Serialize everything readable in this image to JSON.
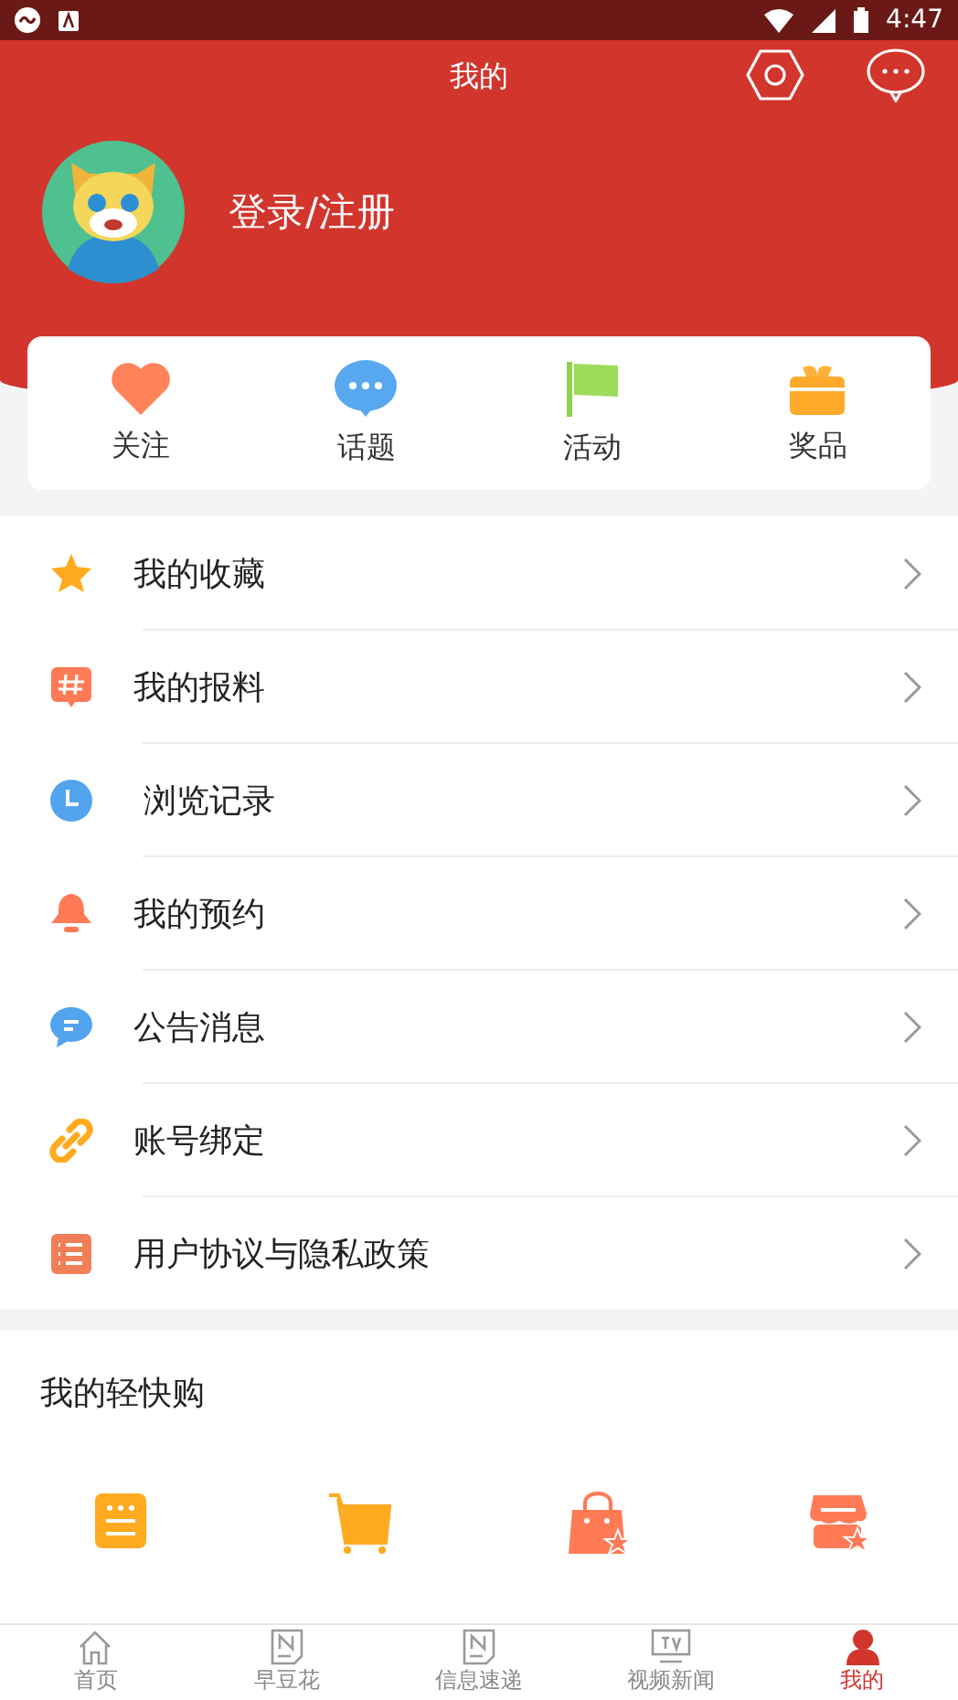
{
  "status_bar": {
    "time": "4:47"
  },
  "header": {
    "title": "我的",
    "login": "登录/注册"
  },
  "quick_actions": [
    {
      "label": "关注"
    },
    {
      "label": "话题"
    },
    {
      "label": "活动"
    },
    {
      "label": "奖品"
    }
  ],
  "menu": [
    {
      "label": "我的收藏"
    },
    {
      "label": "我的报料"
    },
    {
      "label": " 浏览记录"
    },
    {
      "label": "我的预约"
    },
    {
      "label": "公告消息"
    },
    {
      "label": "账号绑定"
    },
    {
      "label": "用户协议与隐私政策"
    }
  ],
  "shop": {
    "title": "我的轻快购"
  },
  "tab_bar": [
    {
      "label": "首页",
      "selected": false
    },
    {
      "label": "早豆花",
      "selected": false
    },
    {
      "label": "信息速递",
      "selected": false
    },
    {
      "label": "视频新闻",
      "selected": false
    },
    {
      "label": "我的",
      "selected": true
    }
  ]
}
